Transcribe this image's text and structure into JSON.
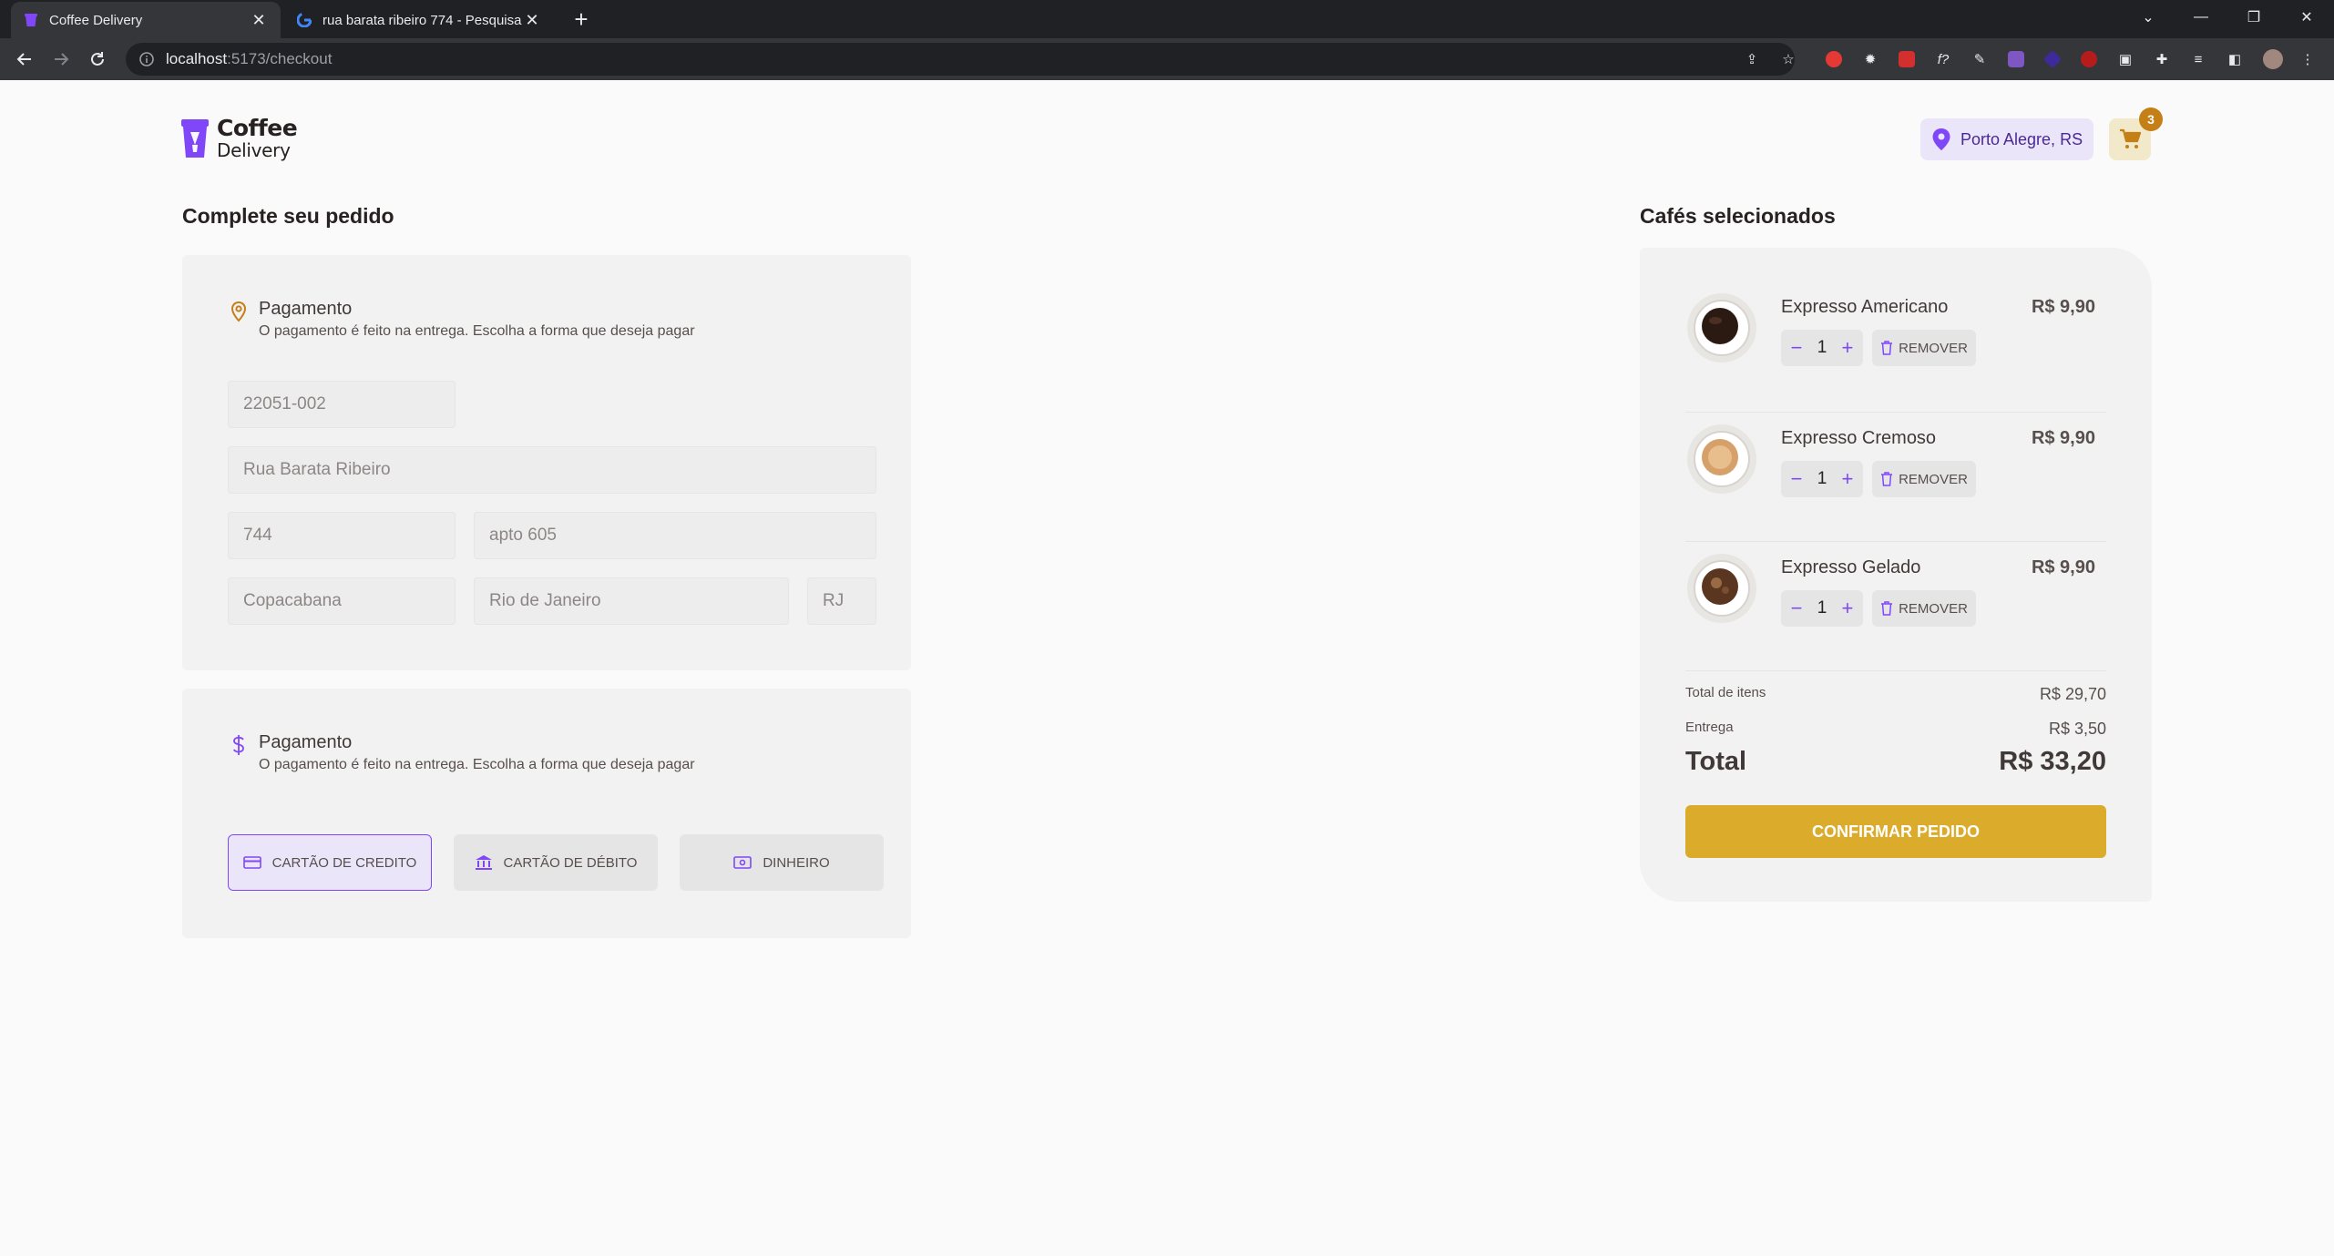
{
  "browser": {
    "tabs": [
      {
        "title": "Coffee Delivery",
        "active": true
      },
      {
        "title": "rua barata ribeiro 774 - Pesquisa",
        "active": false
      }
    ],
    "url_host": "localhost",
    "url_path": ":5173/checkout"
  },
  "header": {
    "logo_line1": "Coffee",
    "logo_line2": "Delivery",
    "location": "Porto Alegre, RS",
    "cart_count": "3"
  },
  "checkout": {
    "title": "Complete seu pedido",
    "address_panel": {
      "title": "Pagamento",
      "subtitle": "O pagamento é feito na entrega. Escolha a forma que deseja pagar",
      "cep": "22051-002",
      "street": "Rua Barata Ribeiro",
      "number": "744",
      "complement": "apto 605",
      "neighborhood": "Copacabana",
      "city": "Rio de Janeiro",
      "state": "RJ"
    },
    "payment_panel": {
      "title": "Pagamento",
      "subtitle": "O pagamento é feito na entrega. Escolha a forma que deseja pagar",
      "options": [
        {
          "label": "CARTÃO DE CREDITO",
          "selected": true
        },
        {
          "label": "CARTÃO DE DÉBITO",
          "selected": false
        },
        {
          "label": "DINHEIRO",
          "selected": false
        }
      ]
    }
  },
  "summary": {
    "title": "Cafés selecionados",
    "items": [
      {
        "name": "Expresso Americano",
        "price": "R$ 9,90",
        "qty": "1",
        "remove": "REMOVER"
      },
      {
        "name": "Expresso Cremoso",
        "price": "R$ 9,90",
        "qty": "1",
        "remove": "REMOVER"
      },
      {
        "name": "Expresso Gelado",
        "price": "R$ 9,90",
        "qty": "1",
        "remove": "REMOVER"
      }
    ],
    "items_total_label": "Total de itens",
    "items_total_value": "R$ 29,70",
    "delivery_label": "Entrega",
    "delivery_value": "R$ 3,50",
    "total_label": "Total",
    "total_value": "R$ 33,20",
    "confirm_label": "CONFIRMAR PEDIDO"
  },
  "colors": {
    "purple": "#8047f8",
    "purple_dark": "#4b2995",
    "yellow": "#dbac2c",
    "yellow_dark": "#c47f17"
  }
}
